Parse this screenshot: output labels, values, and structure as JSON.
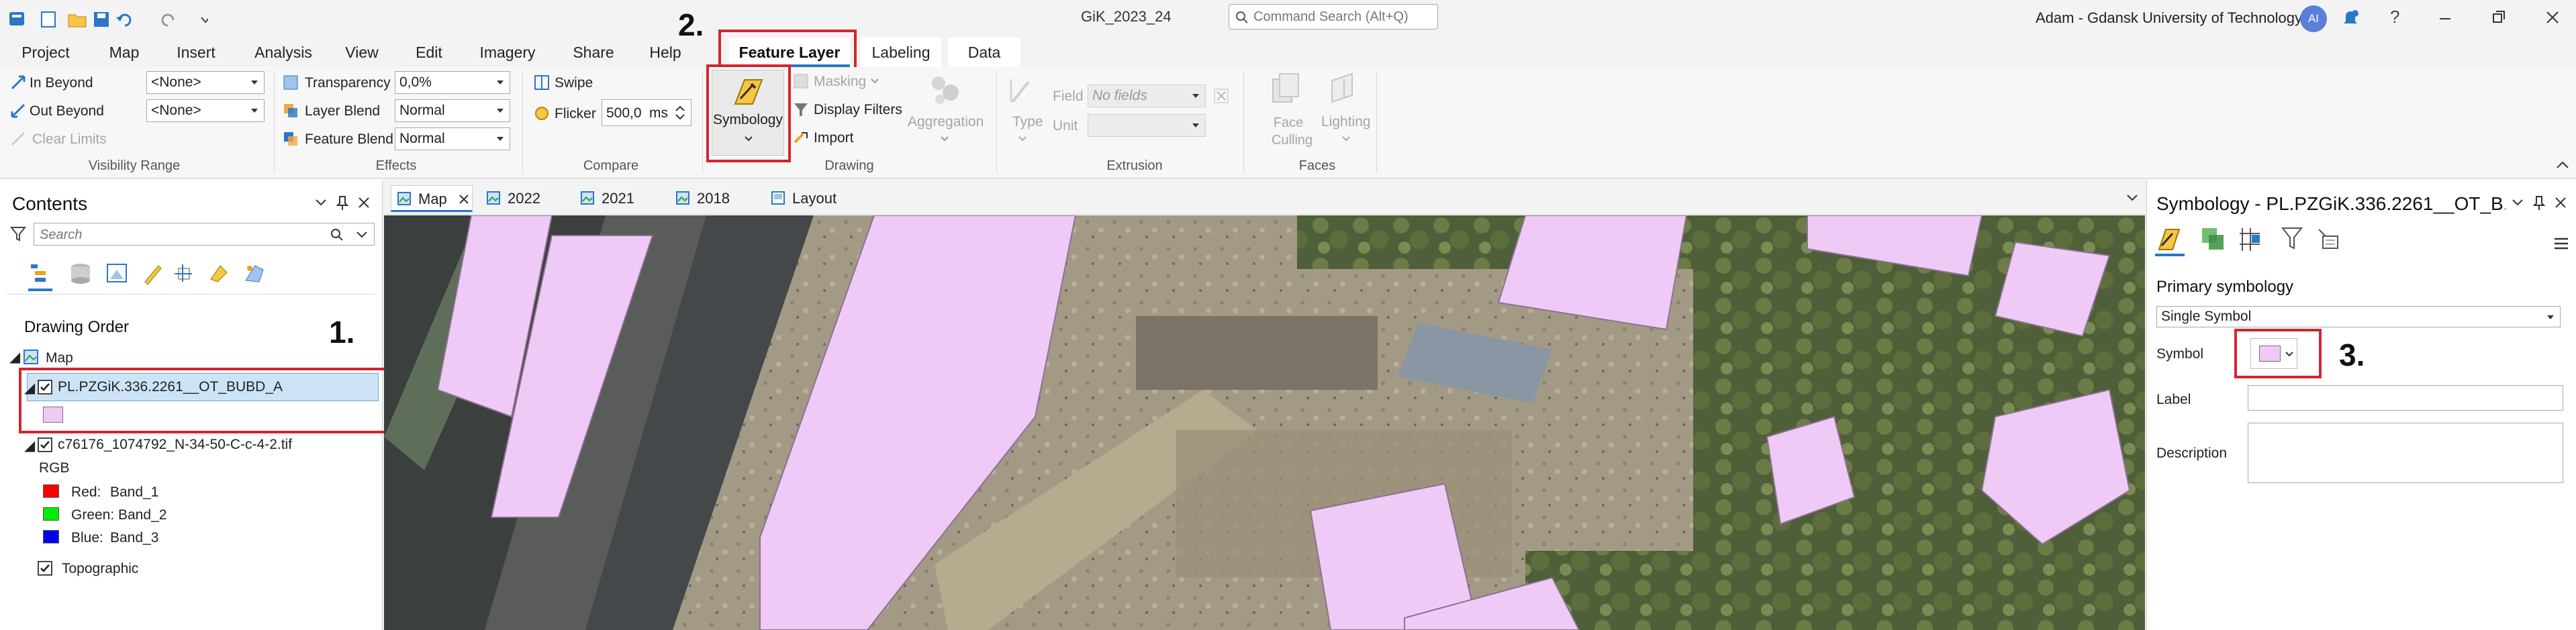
{
  "title_bar": {
    "document_title": "GiK_2023_24",
    "command_search_placeholder": "Command Search (Alt+Q)",
    "user": "Adam - Gdansk University of Technology",
    "avatar_initials": "AI"
  },
  "menu_tabs": [
    "Project",
    "Map",
    "Insert",
    "Analysis",
    "View",
    "Edit",
    "Imagery",
    "Share",
    "Help",
    "Feature Layer",
    "Labeling",
    "Data"
  ],
  "active_tab": "Feature Layer",
  "ribbon": {
    "visibility_range": {
      "in_beyond_label": "In Beyond",
      "in_beyond_value": "<None>",
      "out_beyond_label": "Out Beyond",
      "out_beyond_value": "<None>",
      "clear_limits": "Clear Limits",
      "group_label": "Visibility Range"
    },
    "effects": {
      "transparency_label": "Transparency",
      "transparency_value": "0,0%",
      "layer_blend_label": "Layer Blend",
      "layer_blend_value": "Normal",
      "feature_blend_label": "Feature Blend",
      "feature_blend_value": "Normal",
      "group_label": "Effects"
    },
    "compare": {
      "swipe": "Swipe",
      "flicker_label": "Flicker",
      "flicker_value": "500,0",
      "flicker_unit": "ms",
      "group_label": "Compare"
    },
    "drawing": {
      "symbology": "Symbology",
      "masking": "Masking",
      "display_filters": "Display Filters",
      "import": "Import",
      "aggregation": "Aggregation",
      "group_label": "Drawing"
    },
    "extrusion": {
      "type": "Type",
      "field_label": "Field",
      "field_value": "No fields",
      "unit_label": "Unit",
      "group_label": "Extrusion"
    },
    "faces": {
      "face_culling": "Face Culling",
      "lighting": "Lighting",
      "group_label": "Faces"
    }
  },
  "contents": {
    "title": "Contents",
    "search_placeholder": "Search",
    "drawing_order": "Drawing Order",
    "map_name": "Map",
    "layer1": "PL.PZGiK.336.2261__OT_BUBD_A",
    "layer1_color": "#efcaf7",
    "layer2": "c76176_1074792_N-34-50-C-c-4-2.tif",
    "rgb_label": "RGB",
    "bands": [
      {
        "label": "Red:",
        "value": "Band_1",
        "color": "#ff0000"
      },
      {
        "label": "Green:",
        "value": "Band_2",
        "color": "#00ee00"
      },
      {
        "label": "Blue:",
        "value": "Band_3",
        "color": "#0000ee"
      }
    ],
    "basemap": "Topographic"
  },
  "view_tabs": [
    "Map",
    "2022",
    "2021",
    "2018",
    "Layout"
  ],
  "active_view_tab": "Map",
  "symbology_pane": {
    "title": "Symbology - PL.PZGiK.336.2261__OT_B...",
    "primary_symbology": "Primary symbology",
    "symbology_type": "Single Symbol",
    "symbol_label": "Symbol",
    "symbol_color": "#efcaf7",
    "label_label": "Label",
    "label_value": "",
    "description_label": "Description",
    "description_value": ""
  },
  "annotations": [
    "1.",
    "2.",
    "3."
  ]
}
